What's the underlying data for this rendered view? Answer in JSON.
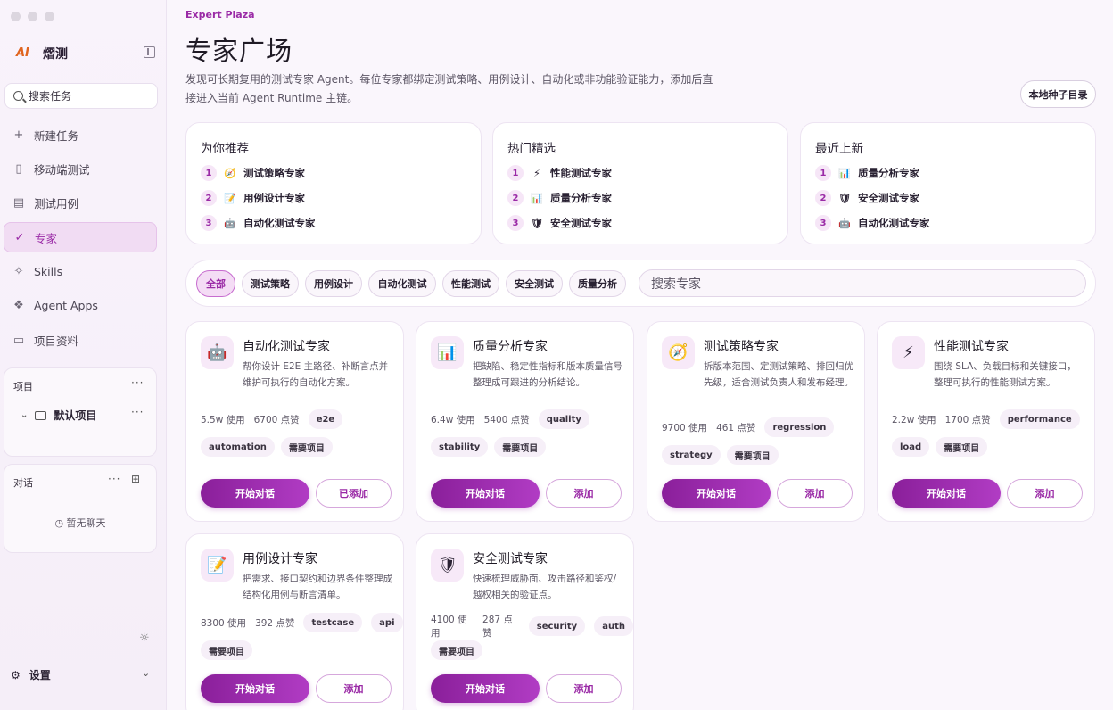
{
  "sidebar": {
    "brand": {
      "logo": "AI",
      "name": "熠测"
    },
    "search_placeholder": "搜索任务",
    "nav": [
      {
        "label": "新建任务",
        "icon": "plus-icon",
        "glyph": "+"
      },
      {
        "label": "移动端测试",
        "icon": "phone-icon",
        "glyph": "▯"
      },
      {
        "label": "测试用例",
        "icon": "clipboard-icon",
        "glyph": "▤"
      },
      {
        "label": "专家",
        "icon": "check-circle-icon",
        "glyph": "✓",
        "active": true
      },
      {
        "label": "Skills",
        "icon": "sparkle-icon",
        "glyph": "✧"
      },
      {
        "label": "Agent Apps",
        "icon": "apps-icon",
        "glyph": "❖"
      },
      {
        "label": "项目资料",
        "icon": "book-icon",
        "glyph": "▭"
      }
    ],
    "projects": {
      "header": "项目",
      "more": "···",
      "default_project": "默认项目"
    },
    "chats": {
      "header": "对话",
      "more": "···",
      "empty": "暂无聊天"
    },
    "settings_label": "设置"
  },
  "header": {
    "eyebrow": "Expert Plaza",
    "title": "专家广场",
    "subtitle": "发现可长期复用的测试专家 Agent。每位专家都绑定测试策略、用例设计、自动化或非功能验证能力，添加后直接进入当前 Agent Runtime 主链。",
    "seed_button": "本地种子目录"
  },
  "recommend": [
    {
      "title": "为你推荐",
      "items": [
        {
          "n": "1",
          "emoji": "🧭",
          "name": "测试策略专家"
        },
        {
          "n": "2",
          "emoji": "📝",
          "name": "用例设计专家"
        },
        {
          "n": "3",
          "emoji": "🤖",
          "name": "自动化测试专家"
        }
      ]
    },
    {
      "title": "热门精选",
      "items": [
        {
          "n": "1",
          "emoji": "⚡",
          "name": "性能测试专家"
        },
        {
          "n": "2",
          "emoji": "📊",
          "name": "质量分析专家"
        },
        {
          "n": "3",
          "emoji": "🛡",
          "name": "安全测试专家"
        }
      ]
    },
    {
      "title": "最近上新",
      "items": [
        {
          "n": "1",
          "emoji": "📊",
          "name": "质量分析专家"
        },
        {
          "n": "2",
          "emoji": "🛡",
          "name": "安全测试专家"
        },
        {
          "n": "3",
          "emoji": "🤖",
          "name": "自动化测试专家"
        }
      ]
    }
  ],
  "filters": {
    "chips": [
      "全部",
      "测试策略",
      "用例设计",
      "自动化测试",
      "性能测试",
      "安全测试",
      "质量分析"
    ],
    "active": "全部",
    "search_placeholder": "搜索专家"
  },
  "experts": [
    {
      "emoji": "🤖",
      "name": "自动化测试专家",
      "desc": "帮你设计 E2E 主路径、补断言点并维护可执行的自动化方案。",
      "uses": "5.5w 使用",
      "likes": "6700 点赞",
      "inline_tags": [
        "e2e"
      ],
      "tags": [
        "automation",
        "需要项目"
      ],
      "start": "开始对话",
      "add": "已添加"
    },
    {
      "emoji": "📊",
      "name": "质量分析专家",
      "desc": "把缺陷、稳定性指标和版本质量信号整理成可跟进的分析结论。",
      "uses": "6.4w 使用",
      "likes": "5400 点赞",
      "inline_tags": [
        "quality"
      ],
      "tags": [
        "stability",
        "需要项目"
      ],
      "start": "开始对话",
      "add": "添加"
    },
    {
      "emoji": "🧭",
      "name": "测试策略专家",
      "desc": "拆版本范围、定测试策略、排回归优先级，适合测试负责人和发布经理。",
      "uses": "9700 使用",
      "likes": "461 点赞",
      "inline_tags": [
        "regression"
      ],
      "tags": [
        "strategy",
        "需要项目"
      ],
      "start": "开始对话",
      "add": "添加"
    },
    {
      "emoji": "⚡",
      "name": "性能测试专家",
      "desc": "围绕 SLA、负载目标和关键接口，整理可执行的性能测试方案。",
      "uses": "2.2w 使用",
      "likes": "1700 点赞",
      "inline_tags": [
        "performance"
      ],
      "tags": [
        "load",
        "需要项目"
      ],
      "start": "开始对话",
      "add": "添加"
    },
    {
      "emoji": "📝",
      "name": "用例设计专家",
      "desc": "把需求、接口契约和边界条件整理成结构化用例与断言清单。",
      "uses": "8300 使用",
      "likes": "392 点赞",
      "inline_tags": [
        "testcase",
        "api"
      ],
      "tags": [
        "需要项目"
      ],
      "start": "开始对话",
      "add": "添加"
    },
    {
      "emoji": "🛡",
      "name": "安全测试专家",
      "desc": "快速梳理威胁面、攻击路径和鉴权/越权相关的验证点。",
      "uses": "4100 使用",
      "likes": "287 点赞",
      "inline_tags": [
        "security",
        "auth"
      ],
      "tags": [
        "需要项目"
      ],
      "start": "开始对话",
      "add": "添加"
    }
  ]
}
